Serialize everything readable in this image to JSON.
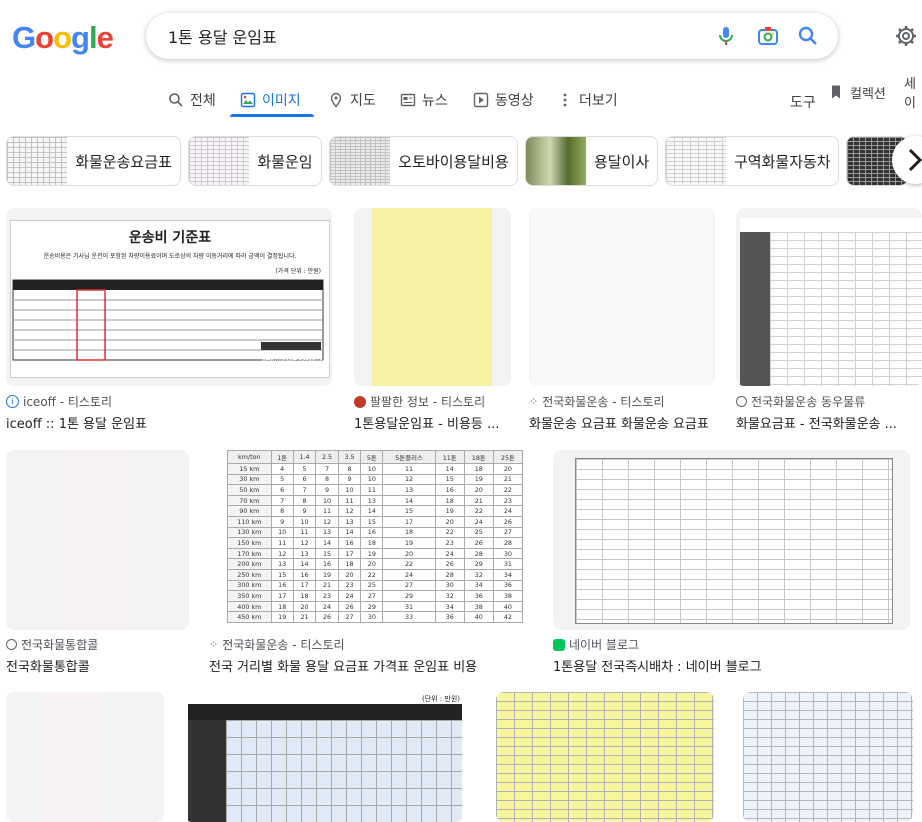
{
  "search": {
    "query": "1톤 용달 운임표"
  },
  "logo_letters": [
    {
      "ch": "G",
      "color": "#4285F4"
    },
    {
      "ch": "o",
      "color": "#EA4335"
    },
    {
      "ch": "o",
      "color": "#FBBC05"
    },
    {
      "ch": "g",
      "color": "#4285F4"
    },
    {
      "ch": "l",
      "color": "#34A853"
    },
    {
      "ch": "e",
      "color": "#EA4335"
    }
  ],
  "nav": {
    "tabs": [
      "전체",
      "이미지",
      "지도",
      "뉴스",
      "동영상",
      "더보기"
    ],
    "tools": "도구",
    "collections": "컬렉션",
    "safe": "세이"
  },
  "chips": [
    "화물운송요금표",
    "화물운임",
    "오토바이용달비용",
    "용달이사",
    "구역화물자동차"
  ],
  "results": [
    {
      "source": "iceoff - 티스토리",
      "title": "iceoff :: 1톤 용달 운임표",
      "img_title": "운송비 기준표",
      "img_sub": "운송비용은 기사님 운전이 포함된 차량이용료이며 도로상의 차량 이동거리에 따라 금액이 결정됩니다.",
      "img_unit": "(가격 단위 : 만원)",
      "watermark": "http://iceoff.tistory.com"
    },
    {
      "source": "팔팔한 정보 - 티스토리",
      "title": "1톤용달운임표 - 비용등 ..."
    },
    {
      "source": "전국화물운송 - 티스토리",
      "title": "화물운송 요금표 화물운송 요금표"
    },
    {
      "source": "전국화물운송 동우물류",
      "title": "화물요금표 - 전국화물운송 ..."
    },
    {
      "source": "전국화물통합콜",
      "title": "전국화물통합콜"
    },
    {
      "source": "전국화물운송 - 티스토리",
      "title": "전국 거리별 화물 용달 요금표 가격표 운임표 비용"
    },
    {
      "source": "네이버 블로그",
      "title": "1톤용달 전국즉시배차 : 네이버 블로그"
    }
  ],
  "table_headers": [
    "km/ton",
    "1톤",
    "1.4",
    "2.5",
    "3.5",
    "5톤",
    "5톤플러스",
    "11톤",
    "18톤",
    "25톤"
  ],
  "table_rows": [
    [
      "15 km",
      "4",
      "5",
      "7",
      "8",
      "10",
      "11",
      "14",
      "18",
      "20"
    ],
    [
      "30 km",
      "5",
      "6",
      "8",
      "9",
      "10",
      "12",
      "15",
      "19",
      "21"
    ],
    [
      "50 km",
      "6",
      "7",
      "9",
      "10",
      "11",
      "13",
      "16",
      "20",
      "22"
    ],
    [
      "70 km",
      "7",
      "8",
      "10",
      "11",
      "13",
      "14",
      "18",
      "21",
      "23"
    ],
    [
      "90 km",
      "8",
      "9",
      "11",
      "12",
      "14",
      "15",
      "19",
      "22",
      "24"
    ],
    [
      "110 km",
      "9",
      "10",
      "12",
      "13",
      "15",
      "17",
      "20",
      "24",
      "26"
    ],
    [
      "130 km",
      "10",
      "11",
      "13",
      "14",
      "16",
      "18",
      "22",
      "25",
      "27"
    ],
    [
      "150 km",
      "11",
      "12",
      "14",
      "16",
      "18",
      "19",
      "23",
      "26",
      "28"
    ],
    [
      "170 km",
      "12",
      "13",
      "15",
      "17",
      "19",
      "20",
      "24",
      "28",
      "30"
    ],
    [
      "200 km",
      "13",
      "14",
      "16",
      "18",
      "20",
      "22",
      "26",
      "29",
      "31"
    ],
    [
      "250 km",
      "15",
      "16",
      "19",
      "20",
      "22",
      "24",
      "28",
      "32",
      "34"
    ],
    [
      "300 km",
      "16",
      "17",
      "21",
      "23",
      "25",
      "27",
      "30",
      "34",
      "36"
    ],
    [
      "350 km",
      "17",
      "18",
      "23",
      "24",
      "27",
      "29",
      "32",
      "36",
      "38"
    ],
    [
      "400 km",
      "18",
      "20",
      "24",
      "26",
      "29",
      "31",
      "34",
      "38",
      "40"
    ],
    [
      "450 km",
      "19",
      "21",
      "26",
      "27",
      "30",
      "33",
      "36",
      "40",
      "42"
    ]
  ],
  "bottom_note": "(단위 : 만원)",
  "colors": {
    "accent": "#1a73e8",
    "tile_bg": "#f1f3f4",
    "text": "#202124",
    "meta": "#4d5156"
  }
}
